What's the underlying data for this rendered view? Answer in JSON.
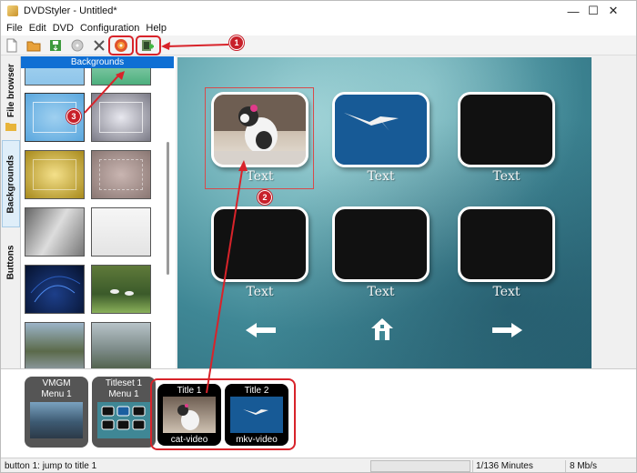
{
  "window": {
    "title": "DVDStyler - Untitled*",
    "minimize": "—",
    "maximize": "☐",
    "close": "✕"
  },
  "menu": [
    "File",
    "Edit",
    "DVD",
    "Configuration",
    "Help"
  ],
  "sidebar_tabs": [
    "File browser",
    "Backgrounds",
    "Buttons"
  ],
  "backgrounds": {
    "header": "Backgrounds"
  },
  "menu_canvas": {
    "button_labels": [
      "Text",
      "Text",
      "Text",
      "Text",
      "Text",
      "Text"
    ]
  },
  "titleset_strip": {
    "vmgm": {
      "name": "VMGM",
      "menu": "Menu 1"
    },
    "titleset": {
      "name": "Titleset 1",
      "menu": "Menu 1"
    },
    "titles": [
      {
        "title": "Title 1",
        "file": "cat-video"
      },
      {
        "title": "Title 2",
        "file": "mkv-video"
      }
    ]
  },
  "annotations": {
    "badge1": "1",
    "badge2": "2",
    "badge3": "3"
  },
  "status": {
    "text": "button 1: jump to title 1",
    "minutes": "1/136 Minutes",
    "rate": "8 Mb/s"
  },
  "colors": {
    "accent": "#d8232a",
    "header_blue": "#0f6fd4"
  }
}
